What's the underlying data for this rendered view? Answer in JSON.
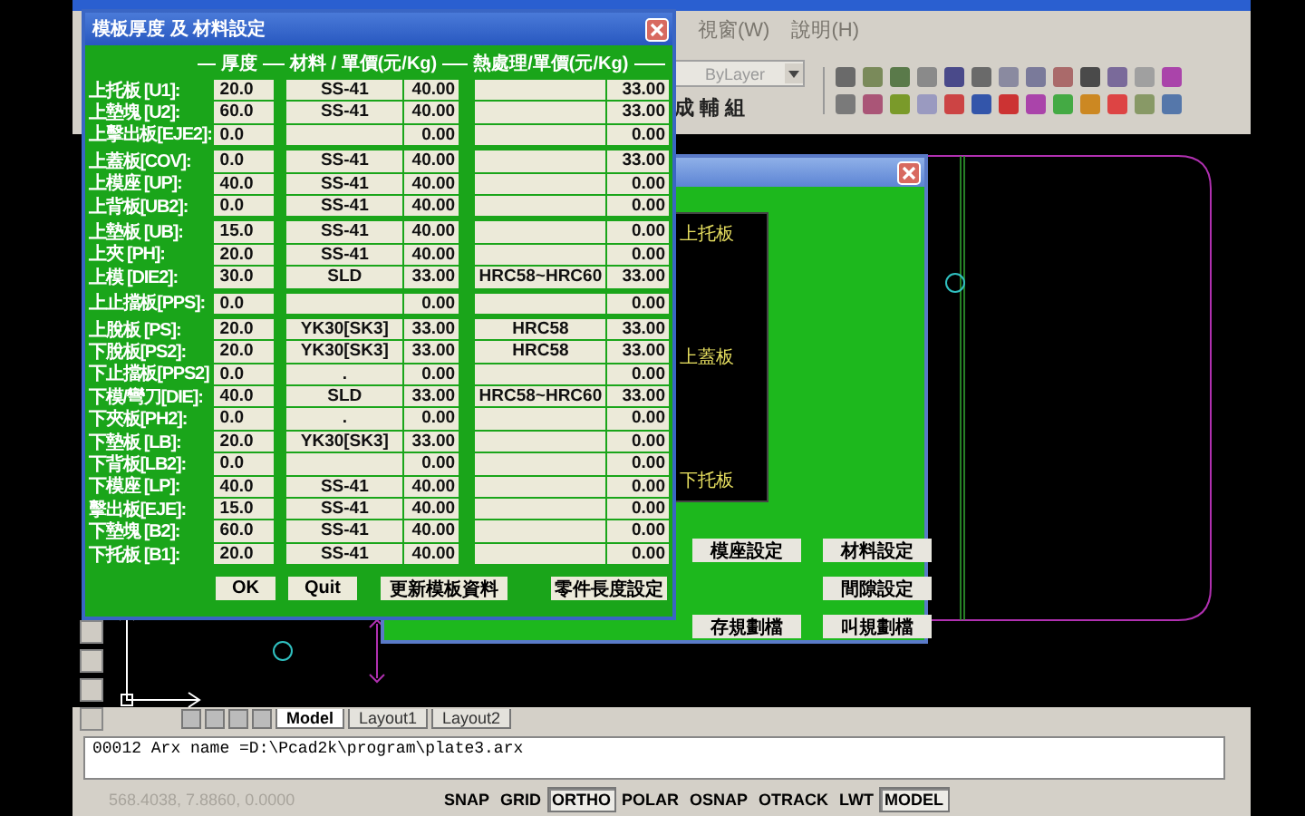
{
  "menu": [
    "視窗(W)",
    "說明(H)"
  ],
  "toolbar": {
    "layer_combo": "ByLayer",
    "group_label": "成輔組"
  },
  "plate_dialog": {
    "title": "模板厚度 及 材料設定",
    "headers": [
      "厚度",
      "材料 / 單價(元/Kg)",
      "熱處理/單價(元/Kg)"
    ],
    "groups": [
      [
        {
          "label": "上托板 [U1]:",
          "thickness": "20.0",
          "material": "SS-41",
          "price": "40.00",
          "heat_price": "33.00"
        },
        {
          "label": "上墊塊 [U2]:",
          "thickness": "60.0",
          "material": "SS-41",
          "price": "40.00",
          "heat_price": "33.00"
        },
        {
          "label": "上擊出板[EJE2]:",
          "thickness": "0.0",
          "price": "0.00",
          "heat_price": "0.00"
        }
      ],
      [
        {
          "label": "上蓋板[COV]:",
          "thickness": "0.0",
          "material": "SS-41",
          "price": "40.00",
          "heat_price": "33.00"
        },
        {
          "label": "上模座 [UP]:",
          "thickness": "40.0",
          "material": "SS-41",
          "price": "40.00",
          "heat_price": "0.00"
        },
        {
          "label": "上背板[UB2]:",
          "thickness": "0.0",
          "material": "SS-41",
          "price": "40.00",
          "heat_price": "0.00"
        }
      ],
      [
        {
          "label": "上墊板 [UB]:",
          "thickness": "15.0",
          "material": "SS-41",
          "price": "40.00",
          "heat_price": "0.00"
        },
        {
          "label": "上夾 [PH]:",
          "thickness": "20.0",
          "material": "SS-41",
          "price": "40.00",
          "heat_price": "0.00"
        },
        {
          "label": "上模 [DIE2]:",
          "thickness": "30.0",
          "material": "SLD",
          "price": "33.00",
          "heat": "HRC58~HRC60",
          "heat_price": "33.00"
        }
      ],
      [
        {
          "label": "上止擋板[PPS]:",
          "thickness": "0.0",
          "price": "0.00",
          "heat_price": "0.00"
        }
      ],
      [
        {
          "label": "上脫板 [PS]:",
          "thickness": "20.0",
          "material": "YK30[SK3]",
          "price": "33.00",
          "heat": "HRC58",
          "heat_price": "33.00"
        },
        {
          "label": "下脫板[PS2]:",
          "thickness": "20.0",
          "material": "YK30[SK3]",
          "price": "33.00",
          "heat": "HRC58",
          "heat_price": "33.00"
        },
        {
          "label": "下止擋板[PPS2]",
          "thickness": "0.0",
          "material": ".",
          "price": "0.00",
          "heat_price": "0.00"
        },
        {
          "label": "下模/彎刀[DIE]:",
          "thickness": "40.0",
          "material": "SLD",
          "price": "33.00",
          "heat": "HRC58~HRC60",
          "heat_price": "33.00"
        },
        {
          "label": "下夾板[PH2]:",
          "thickness": "0.0",
          "material": ".",
          "price": "0.00",
          "heat_price": "0.00"
        },
        {
          "label": "下墊板 [LB]:",
          "thickness": "20.0",
          "material": "YK30[SK3]",
          "price": "33.00",
          "heat_price": "0.00"
        },
        {
          "label": "下背板[LB2]:",
          "thickness": "0.0",
          "price": "0.00",
          "heat_price": "0.00"
        },
        {
          "label": "下模座 [LP]:",
          "thickness": "40.0",
          "material": "SS-41",
          "price": "40.00",
          "heat_price": "0.00"
        },
        {
          "label": "擊出板[EJE]:",
          "thickness": "15.0",
          "material": "SS-41",
          "price": "40.00",
          "heat_price": "0.00"
        },
        {
          "label": "下墊塊 [B2]:",
          "thickness": "60.0",
          "material": "SS-41",
          "price": "40.00",
          "heat_price": "0.00"
        },
        {
          "label": "下托板 [B1]:",
          "thickness": "20.0",
          "material": "SS-41",
          "price": "40.00",
          "heat_price": "0.00"
        }
      ]
    ],
    "buttons": [
      "OK",
      "Quit",
      "更新模板資料",
      "零件長度設定"
    ]
  },
  "setup_dialog": {
    "preview_labels": [
      "上托板",
      "上蓋板",
      "下托板"
    ],
    "button_rows": [
      {
        "left": "模座設定",
        "right": "材料設定"
      },
      {
        "right": "間隙設定"
      },
      {
        "left": "存規劃檔",
        "right": "叫規劃檔"
      }
    ]
  },
  "layout_tabs": [
    {
      "label": "Model",
      "selected": true
    },
    {
      "label": "Layout1",
      "selected": false
    },
    {
      "label": "Layout2",
      "selected": false
    }
  ],
  "command_line": "00012  Arx name =D:\\Pcad2k\\program\\plate3.arx",
  "status_bar": {
    "coordinates": "568.4038, 7.8860, 0.0000",
    "toggles": [
      {
        "label": "SNAP",
        "on": false
      },
      {
        "label": "GRID",
        "on": false
      },
      {
        "label": "ORTHO",
        "on": true
      },
      {
        "label": "POLAR",
        "on": false
      },
      {
        "label": "OSNAP",
        "on": false
      },
      {
        "label": "OTRACK",
        "on": false
      },
      {
        "label": "LWT",
        "on": false
      },
      {
        "label": "MODEL",
        "on": true
      }
    ]
  }
}
